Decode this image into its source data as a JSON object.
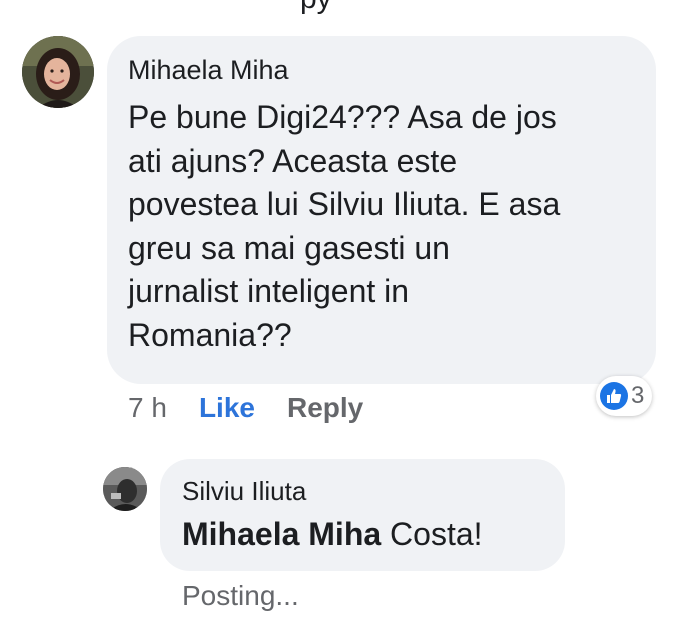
{
  "header_cut_text": "py",
  "comment": {
    "author": "Mihaela Miha",
    "text": "Pe bune Digi24??? Asa de jos\nati ajuns? Aceasta este\npovestea lui Silviu Iliuta. E asa\ngreu sa mai gasesti un\njurnalist inteligent in\nRomania??",
    "time": "7 h",
    "like_label": "Like",
    "reply_label": "Reply",
    "reaction": {
      "icon": "thumbs-up-icon",
      "count": "3"
    },
    "colors": {
      "like": "#2d74da",
      "reaction": "#1b74e4",
      "bubble": "#f0f2f5"
    }
  },
  "reply": {
    "author": "Silviu Iliuta",
    "mention": "Mihaela Miha",
    "text": " Costa!",
    "status": "Posting..."
  }
}
